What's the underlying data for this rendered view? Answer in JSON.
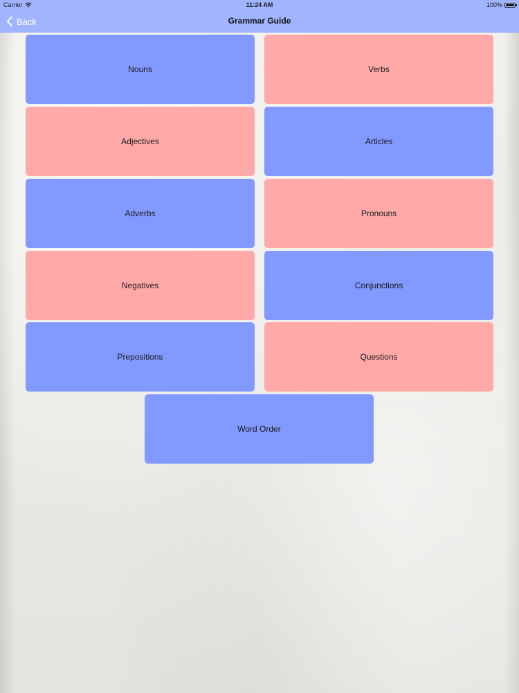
{
  "status_bar": {
    "carrier": "Carrier",
    "time": "11:24 AM",
    "battery": "100%"
  },
  "nav": {
    "back_label": "Back",
    "title": "Grammar Guide"
  },
  "colors": {
    "nav_bar": "#a0b4ff",
    "tile_blue": "#8299ff",
    "tile_pink": "#ffaaa9"
  },
  "tiles": [
    {
      "label": "Nouns",
      "color": "blue"
    },
    {
      "label": "Verbs",
      "color": "pink"
    },
    {
      "label": "Adjectives",
      "color": "pink"
    },
    {
      "label": "Articles",
      "color": "blue"
    },
    {
      "label": "Adverbs",
      "color": "blue"
    },
    {
      "label": "Pronouns",
      "color": "pink"
    },
    {
      "label": "Negatives",
      "color": "pink"
    },
    {
      "label": "Conjunctions",
      "color": "blue"
    },
    {
      "label": "Prepositions",
      "color": "blue"
    },
    {
      "label": "Questions",
      "color": "pink"
    },
    {
      "label": "Word Order",
      "color": "blue"
    }
  ]
}
